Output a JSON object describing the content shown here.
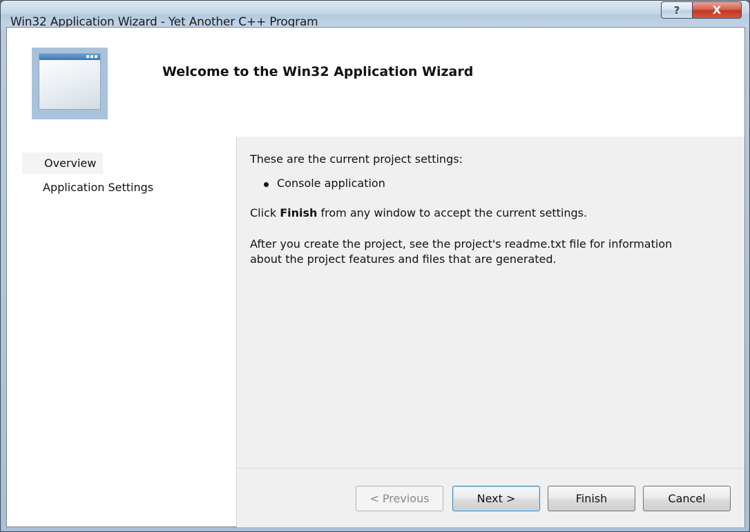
{
  "window": {
    "title": "Win32 Application Wizard - Yet Another C++ Program",
    "help_label": "?",
    "close_label": "X"
  },
  "banner": {
    "title": "Welcome to the Win32 Application Wizard"
  },
  "nav": {
    "items": [
      {
        "label": "Overview",
        "active": true
      },
      {
        "label": "Application Settings",
        "active": false
      }
    ]
  },
  "content": {
    "intro": "These are the current project settings:",
    "bullet": "Console application",
    "finish_pre": "Click ",
    "finish_bold": "Finish",
    "finish_post": " from any window to accept the current settings.",
    "readme_note": "After you create the project, see the project's readme.txt file for information about the project features and files that are generated."
  },
  "buttons": {
    "previous": "< Previous",
    "next": "Next >",
    "finish": "Finish",
    "cancel": "Cancel"
  }
}
